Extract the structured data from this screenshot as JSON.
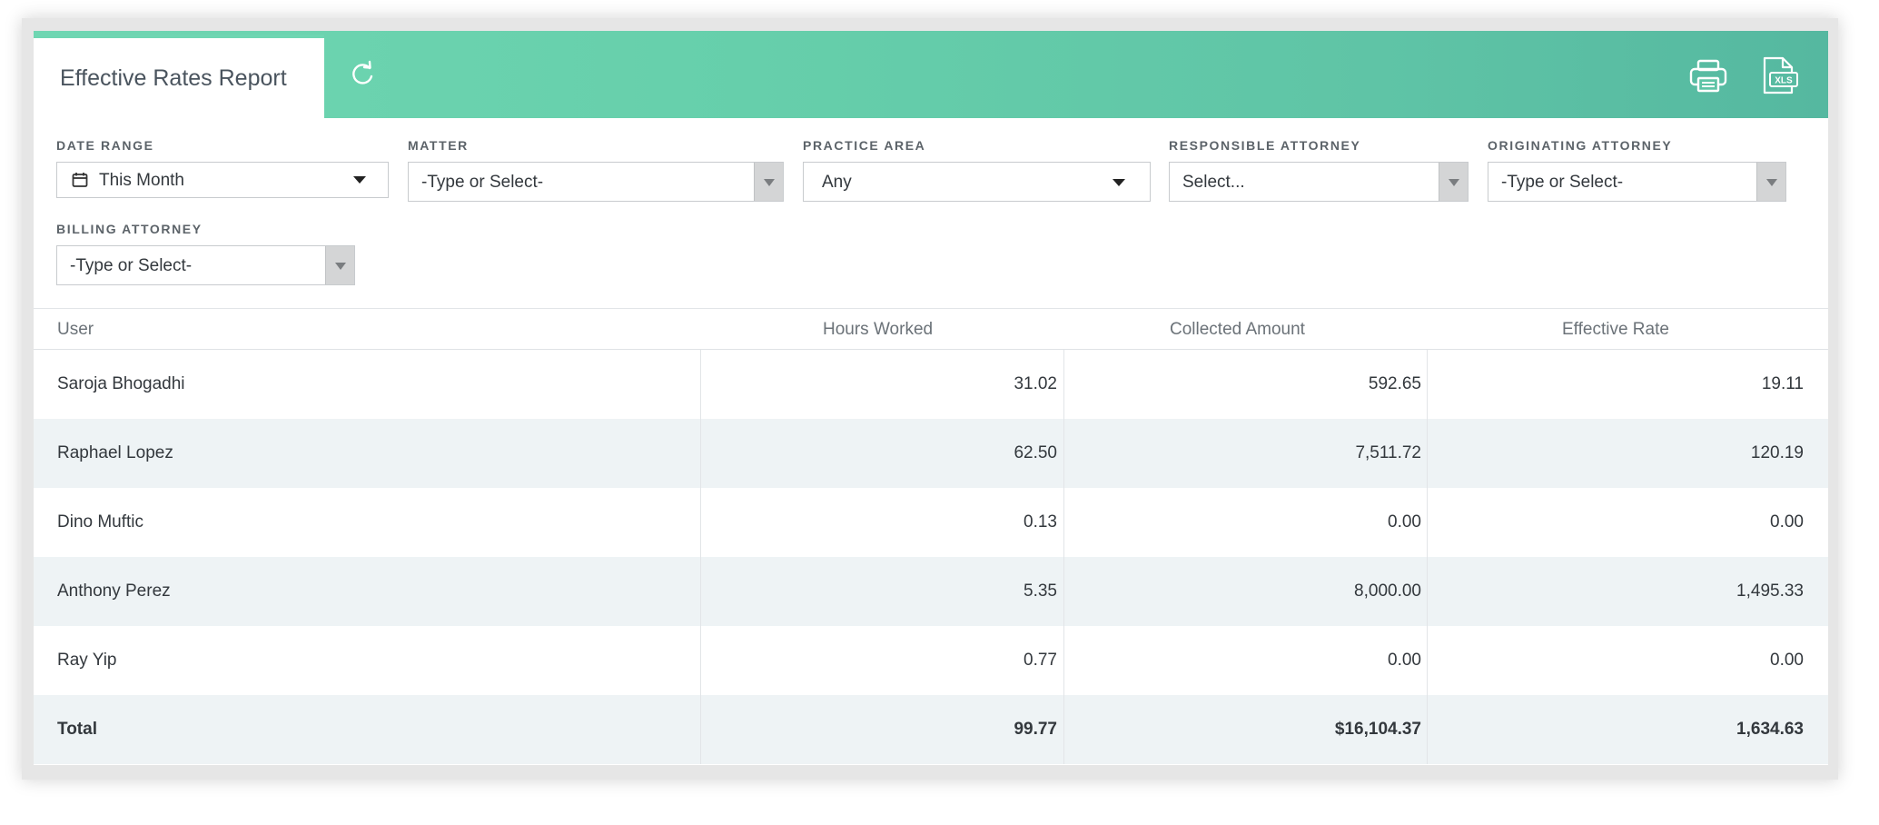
{
  "header": {
    "title": "Effective Rates Report",
    "refresh_icon": "refresh-icon",
    "print_icon": "printer-icon",
    "export_icon": "xls-file-icon",
    "export_icon_text": "XLS",
    "accent_color": "#66cfab"
  },
  "filters": {
    "date_range": {
      "label": "DATE RANGE",
      "value": "This Month",
      "icon": "calendar-icon"
    },
    "matter": {
      "label": "MATTER",
      "value": "-Type or Select-"
    },
    "practice_area": {
      "label": "PRACTICE AREA",
      "value": "Any"
    },
    "responsible_attorney": {
      "label": "RESPONSIBLE ATTORNEY",
      "value": "Select..."
    },
    "originating_attorney": {
      "label": "ORIGINATING ATTORNEY",
      "value": "-Type or Select-"
    },
    "billing_attorney": {
      "label": "BILLING ATTORNEY",
      "value": "-Type or Select-"
    }
  },
  "table": {
    "columns": [
      "User",
      "Hours Worked",
      "Collected Amount",
      "Effective Rate"
    ],
    "rows": [
      {
        "user": "Saroja Bhogadhi",
        "hours": "31.02",
        "collected": "592.65",
        "rate": "19.11"
      },
      {
        "user": "Raphael Lopez",
        "hours": "62.50",
        "collected": "7,511.72",
        "rate": "120.19"
      },
      {
        "user": "Dino Muftic",
        "hours": "0.13",
        "collected": "0.00",
        "rate": "0.00"
      },
      {
        "user": "Anthony Perez",
        "hours": "5.35",
        "collected": "8,000.00",
        "rate": "1,495.33"
      },
      {
        "user": "Ray Yip",
        "hours": "0.77",
        "collected": "0.00",
        "rate": "0.00"
      }
    ],
    "total": {
      "label": "Total",
      "hours": "99.77",
      "collected": "$16,104.37",
      "rate": "1,634.63"
    }
  }
}
